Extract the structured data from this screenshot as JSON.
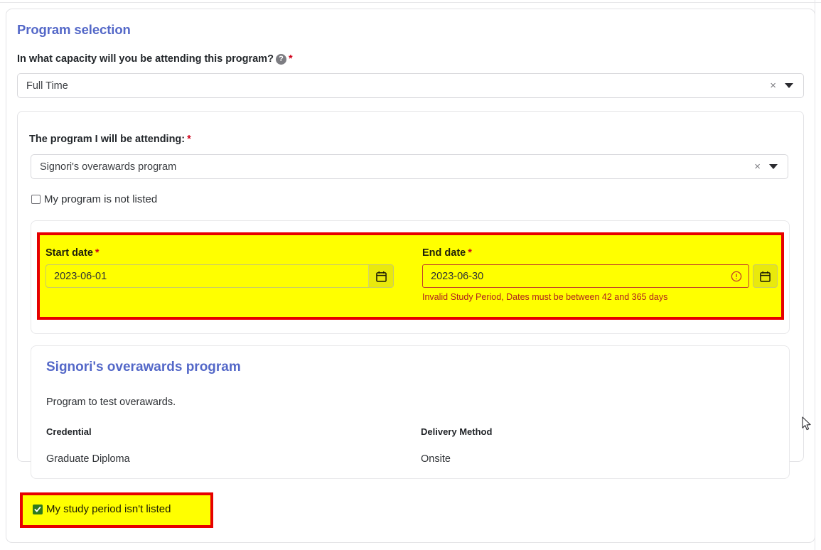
{
  "section": {
    "title": "Program selection"
  },
  "capacity": {
    "label": "In what capacity will you be attending this program?",
    "help_icon": "help-circle-icon",
    "required_marker": "*",
    "value": "Full Time",
    "clear_icon": "×",
    "caret_icon": "chevron-down-icon"
  },
  "program": {
    "label": "The program I will be attending:",
    "required_marker": "*",
    "value": "Signori's overawards program",
    "clear_icon": "×",
    "not_listed_label": "My program is not listed",
    "not_listed_checked": false
  },
  "dates": {
    "start": {
      "label": "Start date",
      "required_marker": "*",
      "value": "2023-06-01",
      "calendar_icon": "calendar-icon"
    },
    "end": {
      "label": "End date",
      "required_marker": "*",
      "value": "2023-06-30",
      "calendar_icon": "calendar-icon",
      "warning_icon": "exclamation-circle-icon",
      "error_message": "Invalid Study Period, Dates must be between 42 and 365 days"
    }
  },
  "details": {
    "title": "Signori's overawards program",
    "description": "Program to test overawards.",
    "credential_head": "Credential",
    "credential_value": "Graduate Diploma",
    "delivery_head": "Delivery Method",
    "delivery_value": "Onsite"
  },
  "study_period": {
    "label": "My study period isn't listed",
    "checked": true
  },
  "colors": {
    "accent": "#5468c8",
    "required": "#d0021b",
    "highlight_fill": "#ffff00",
    "highlight_border": "#e60000",
    "error_text": "#b02020",
    "checkbox_checked": "#2f7a1e"
  }
}
